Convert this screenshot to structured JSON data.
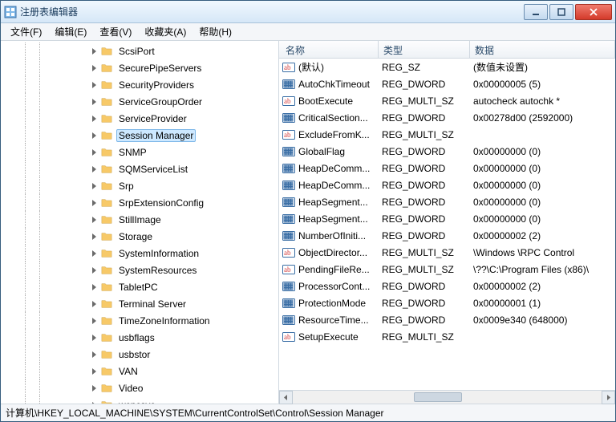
{
  "window": {
    "title": "注册表编辑器"
  },
  "menu": {
    "file": "文件(F)",
    "edit": "编辑(E)",
    "view": "查看(V)",
    "favorites": "收藏夹(A)",
    "help": "帮助(H)"
  },
  "tree": {
    "items": [
      {
        "label": "ScsiPort",
        "selected": false
      },
      {
        "label": "SecurePipeServers",
        "selected": false
      },
      {
        "label": "SecurityProviders",
        "selected": false
      },
      {
        "label": "ServiceGroupOrder",
        "selected": false
      },
      {
        "label": "ServiceProvider",
        "selected": false
      },
      {
        "label": "Session Manager",
        "selected": true
      },
      {
        "label": "SNMP",
        "selected": false
      },
      {
        "label": "SQMServiceList",
        "selected": false
      },
      {
        "label": "Srp",
        "selected": false
      },
      {
        "label": "SrpExtensionConfig",
        "selected": false
      },
      {
        "label": "StillImage",
        "selected": false
      },
      {
        "label": "Storage",
        "selected": false
      },
      {
        "label": "SystemInformation",
        "selected": false
      },
      {
        "label": "SystemResources",
        "selected": false
      },
      {
        "label": "TabletPC",
        "selected": false
      },
      {
        "label": "Terminal Server",
        "selected": false
      },
      {
        "label": "TimeZoneInformation",
        "selected": false
      },
      {
        "label": "usbflags",
        "selected": false
      },
      {
        "label": "usbstor",
        "selected": false
      },
      {
        "label": "VAN",
        "selected": false
      },
      {
        "label": "Video",
        "selected": false
      },
      {
        "label": "wcncsvc",
        "selected": false
      }
    ]
  },
  "columns": {
    "name": "名称",
    "type": "类型",
    "data": "数据"
  },
  "values": [
    {
      "icon": "ab",
      "name": "(默认)",
      "type": "REG_SZ",
      "data": "(数值未设置)"
    },
    {
      "icon": "num",
      "name": "AutoChkTimeout",
      "type": "REG_DWORD",
      "data": "0x00000005 (5)"
    },
    {
      "icon": "ab",
      "name": "BootExecute",
      "type": "REG_MULTI_SZ",
      "data": "autocheck autochk *"
    },
    {
      "icon": "num",
      "name": "CriticalSection...",
      "type": "REG_DWORD",
      "data": "0x00278d00 (2592000)"
    },
    {
      "icon": "ab",
      "name": "ExcludeFromK...",
      "type": "REG_MULTI_SZ",
      "data": ""
    },
    {
      "icon": "num",
      "name": "GlobalFlag",
      "type": "REG_DWORD",
      "data": "0x00000000 (0)"
    },
    {
      "icon": "num",
      "name": "HeapDeComm...",
      "type": "REG_DWORD",
      "data": "0x00000000 (0)"
    },
    {
      "icon": "num",
      "name": "HeapDeComm...",
      "type": "REG_DWORD",
      "data": "0x00000000 (0)"
    },
    {
      "icon": "num",
      "name": "HeapSegment...",
      "type": "REG_DWORD",
      "data": "0x00000000 (0)"
    },
    {
      "icon": "num",
      "name": "HeapSegment...",
      "type": "REG_DWORD",
      "data": "0x00000000 (0)"
    },
    {
      "icon": "num",
      "name": "NumberOfIniti...",
      "type": "REG_DWORD",
      "data": "0x00000002 (2)"
    },
    {
      "icon": "ab",
      "name": "ObjectDirector...",
      "type": "REG_MULTI_SZ",
      "data": "\\Windows \\RPC Control"
    },
    {
      "icon": "ab",
      "name": "PendingFileRe...",
      "type": "REG_MULTI_SZ",
      "data": "\\??\\C:\\Program Files (x86)\\"
    },
    {
      "icon": "num",
      "name": "ProcessorCont...",
      "type": "REG_DWORD",
      "data": "0x00000002 (2)"
    },
    {
      "icon": "num",
      "name": "ProtectionMode",
      "type": "REG_DWORD",
      "data": "0x00000001 (1)"
    },
    {
      "icon": "num",
      "name": "ResourceTime...",
      "type": "REG_DWORD",
      "data": "0x0009e340 (648000)"
    },
    {
      "icon": "ab",
      "name": "SetupExecute",
      "type": "REG_MULTI_SZ",
      "data": ""
    }
  ],
  "statusbar": {
    "path": "计算机\\HKEY_LOCAL_MACHINE\\SYSTEM\\CurrentControlSet\\Control\\Session Manager"
  }
}
